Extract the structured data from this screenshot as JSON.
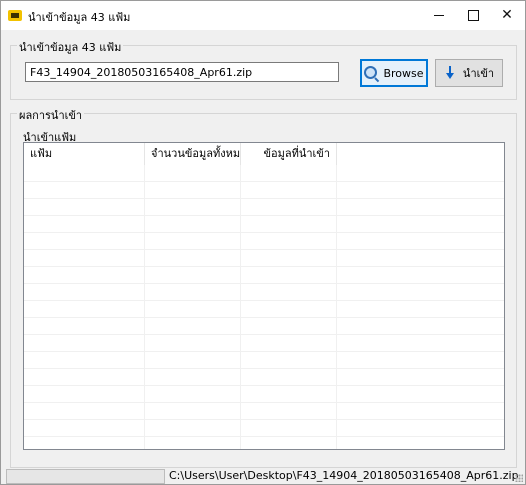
{
  "window": {
    "title": "นำเข้าข้อมูล 43 แฟ้ม",
    "controls": [
      "minimize",
      "maximize",
      "close"
    ]
  },
  "import_group": {
    "label": "นำเข้าข้อมูล 43 แฟ้ม",
    "file_value": "F43_14904_20180503165408_Apr61.zip",
    "browse_label": "Browse",
    "import_label": "นำเข้า"
  },
  "results_group": {
    "label": "ผลการนำเข้า",
    "list_title": "นำเข้าแฟ้ม",
    "columns": [
      "แฟ้ม",
      "จำนวนข้อมูลทั้งหมด",
      "ข้อมูลที่นำเข้า"
    ],
    "rows": []
  },
  "statusbar": {
    "progress": 0,
    "path": "C:\\Users\\User\\Desktop\\F43_14904_20180503165408_Apr61.zip"
  },
  "colors": {
    "accent": "#0078d7",
    "window_bg": "#f0f0f0",
    "progress_fill": "#06b025"
  },
  "icons": [
    "app-icon",
    "search-icon",
    "download-arrow-icon"
  ]
}
